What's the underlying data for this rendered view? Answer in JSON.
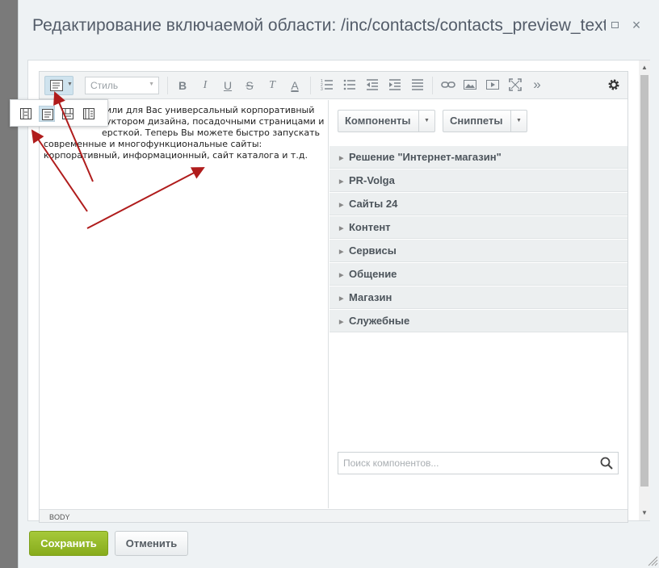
{
  "dialog": {
    "title": "Редактирование включаемой области: /inc/contacts/contacts_preview_text.ph",
    "maximize_icon": "maximize-icon",
    "close_icon": "close-icon",
    "close_glyph": "×"
  },
  "toolbar": {
    "style_select_value": "Стиль",
    "buttons": [
      "view-mode-icon",
      "bold-icon",
      "italic-icon",
      "underline-icon",
      "strikethrough-icon",
      "clear-format-icon",
      "text-color-icon",
      "ordered-list-icon",
      "unordered-list-icon",
      "outdent-icon",
      "indent-icon",
      "justify-icon",
      "link-icon",
      "image-icon",
      "video-icon",
      "fullscreen-icon",
      "more-icon",
      "settings-icon"
    ],
    "bold_glyph": "B",
    "italic_glyph": "I",
    "underline_glyph": "U",
    "strike_glyph": "S",
    "clear_glyph": "T",
    "color_glyph": "A",
    "more_glyph": "»"
  },
  "view_popup": {
    "options": [
      "code-view-icon",
      "visual-view-icon",
      "split-horizontal-icon",
      "split-vertical-icon"
    ]
  },
  "editor": {
    "text": "Вы получили для Вас универсальный корпоративный конструктором дизайна, посадочными страницами и адаптивной версткой. Теперь Вы можете быстро запускать современные и многофункциональные сайты: корпоративный, информационный, сайт каталога и т.д.",
    "text_visible_lines": [
      "или для Вас универсальный корпоративный",
      "укто­ром дизайна, посадочными страницами и",
      "ерсткой. Теперь Вы можете быстро запускать",
      "современные и многофункциональные сайты:",
      "корпоративный, информационный, сайт каталога и т.д."
    ],
    "status_bar": "BODY"
  },
  "components": {
    "components_button": "Компоненты",
    "snippets_button": "Сниппеты",
    "tree": [
      "Решение \"Интернет-магазин\"",
      "PR-Volga",
      "Сайты 24",
      "Контент",
      "Сервисы",
      "Общение",
      "Магазин",
      "Служебные"
    ],
    "search_placeholder": "Поиск компонентов..."
  },
  "footer": {
    "save_label": "Сохранить",
    "cancel_label": "Отменить"
  },
  "colors": {
    "save_button": "#94b827",
    "annotation_arrows": "#b01c1c",
    "active_view": "#cfe3ee"
  }
}
